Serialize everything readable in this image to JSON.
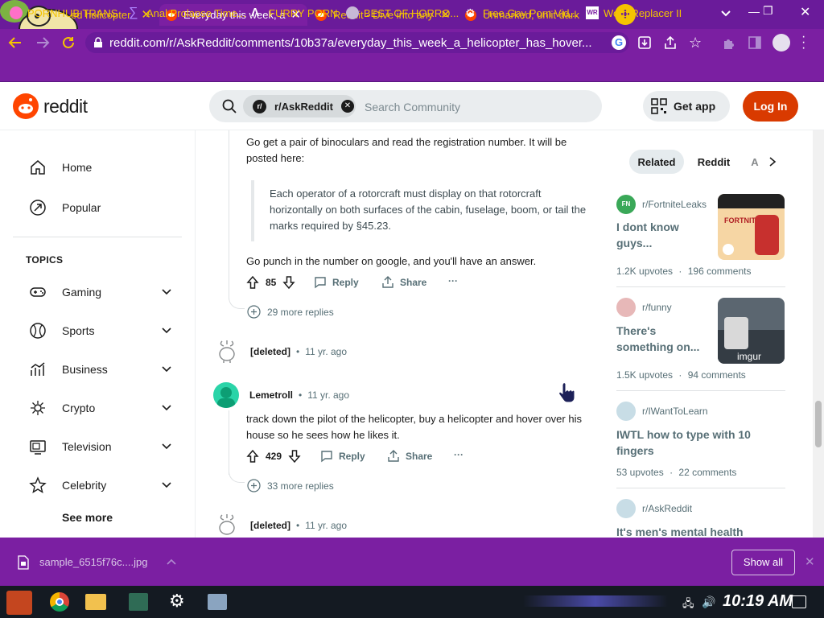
{
  "tabs": [
    {
      "label": "ed helicopter",
      "state": "inactive"
    },
    {
      "label": "Everyday this week, a",
      "state": "active"
    },
    {
      "label": "Reddit - Dive into any",
      "state": "inactive"
    },
    {
      "label": "Unmarked, unlit dark",
      "state": "inactive"
    }
  ],
  "window": {
    "minimize": "—",
    "restore": "❐",
    "close": "✕"
  },
  "address": {
    "url": "reddit.com/r/AskReddit/comments/10b37a/everyday_this_week_a_helicopter_has_hover..."
  },
  "bookmarks": [
    {
      "label": "PORNHUB TRANS"
    },
    {
      "label": "Anal Prolapse Time..."
    },
    {
      "label": "FURRY PORN"
    },
    {
      "label": "BEST OF HORRO..."
    },
    {
      "label": "Free Gay Porn Vid..."
    },
    {
      "label": "Word Replacer II"
    }
  ],
  "header": {
    "logo_text": "reddit",
    "community_chip": "r/AskReddit",
    "search_placeholder": "Search Community",
    "get_app": "Get app",
    "login": "Log In"
  },
  "sidebar": {
    "home": "Home",
    "popular": "Popular",
    "topics_heading": "TOPICS",
    "topics": [
      "Gaming",
      "Sports",
      "Business",
      "Crypto",
      "Television",
      "Celebrity"
    ],
    "see_more": "See more"
  },
  "comments": {
    "c1": {
      "text": "Go get a pair of binoculars and read the registration number. It will be posted here:",
      "quote": "Each operator of a rotorcraft must display on that rotorcraft horizontally on both surfaces of the cabin, fuselage, boom, or tail the marks required by §45.23.",
      "text2": "Go punch in the number on google, and you'll have an answer.",
      "votes": "85",
      "reply": "Reply",
      "share": "Share",
      "more": "···",
      "more_replies": "29 more replies"
    },
    "c2": {
      "author": "[deleted]",
      "sep": "•",
      "time": "11 yr. ago"
    },
    "c3": {
      "author": "Lemetroll",
      "sep": "•",
      "time": "11 yr. ago",
      "text": "track down the pilot of the helicopter, buy a helicopter and hover over his house so he sees how he likes it.",
      "votes": "429",
      "reply": "Reply",
      "share": "Share",
      "more": "···",
      "more_replies": "33 more replies"
    },
    "c4": {
      "author": "[deleted]",
      "sep": "•",
      "time": "11 yr. ago"
    }
  },
  "right": {
    "tabs": [
      "Related",
      "Reddit",
      "A"
    ],
    "posts": [
      {
        "sub": "r/FortniteLeaks",
        "title_l1": "I dont know",
        "title_l2": "guys...",
        "upvotes": "1.2K upvotes",
        "sep": "·",
        "comments": "196 comments",
        "thumb_caption": "FORTNITE"
      },
      {
        "sub": "r/funny",
        "title_l1": "There's",
        "title_l2": "something on...",
        "upvotes": "1.5K upvotes",
        "sep": "·",
        "comments": "94 comments",
        "thumb_caption": "imgur"
      },
      {
        "sub": "r/IWantToLearn",
        "title_l1": "IWTL how to type with 10",
        "title_l2": "fingers",
        "upvotes": "53 upvotes",
        "sep": "·",
        "comments": "22 comments"
      },
      {
        "sub": "r/AskReddit",
        "title_l1": "It's men's mental health"
      }
    ]
  },
  "download": {
    "filename": "sample_6515f76c....jpg",
    "show_all": "Show all",
    "close": "✕"
  },
  "taskbar": {
    "time": "10:19 AM"
  },
  "colors": {
    "browser_purple": "#7b1fa2",
    "reddit_orange": "#ff4500",
    "login_red": "#d93a00",
    "bookmark_yellow": "#f5c400"
  }
}
